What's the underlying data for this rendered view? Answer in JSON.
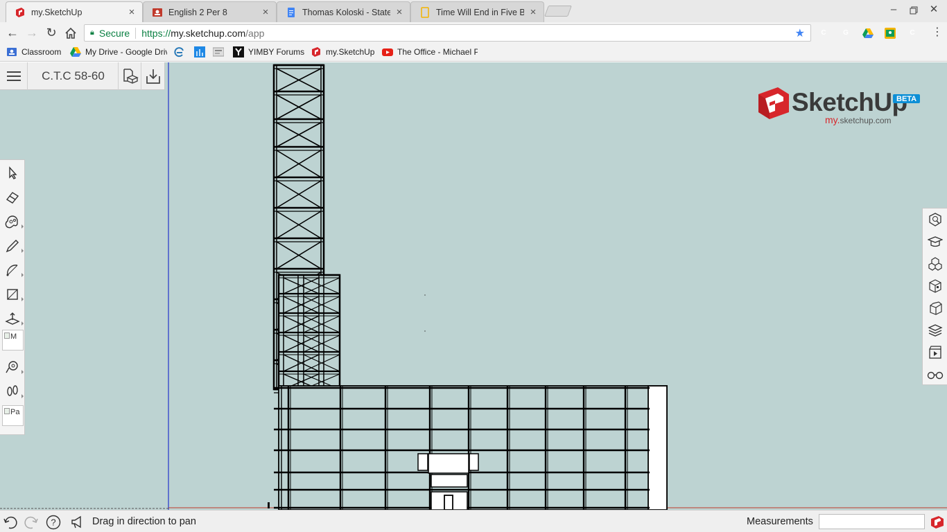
{
  "browser": {
    "tabs": [
      {
        "title": "my.SketchUp",
        "icon": "sketchup-icon",
        "active": true
      },
      {
        "title": "English 2 Per 8",
        "icon": "classroom-icon",
        "active": false
      },
      {
        "title": "Thomas Koloski - Statem",
        "icon": "docs-icon",
        "active": false
      },
      {
        "title": "Time Will End in Five Bill",
        "icon": "slides-icon",
        "active": false
      }
    ],
    "address": {
      "secure_label": "Secure",
      "scheme": "https://",
      "host": "my.sketchup.com",
      "path": "/app"
    },
    "extensions": [
      {
        "letter": "C",
        "color": "#a9a9a9"
      },
      {
        "letter": "G",
        "color": "#b3b3b3"
      },
      {
        "letter": "",
        "color": "#1e9f50"
      },
      {
        "letter": "",
        "color": "#f1b400"
      },
      {
        "letter": "C",
        "color": "#7a7a7a"
      }
    ],
    "bookmarks": [
      {
        "label": "Classroom",
        "icon": "classroom-icon"
      },
      {
        "label": "My Drive - Google Driv",
        "icon": "drive-icon"
      },
      {
        "label": "",
        "icon": "refresh-edge-icon"
      },
      {
        "label": "",
        "icon": "bars-icon"
      },
      {
        "label": "",
        "icon": "thumbnail-icon"
      },
      {
        "label": "YIMBY Forums",
        "icon": "yimby-icon"
      },
      {
        "label": "my.SketchUp",
        "icon": "sketchup-icon"
      },
      {
        "label": "The Office - Michael P",
        "icon": "youtube-icon"
      }
    ]
  },
  "app": {
    "model_title": "C.T.C 58-60",
    "logo": {
      "word": "SketchUp",
      "badge": "BETA",
      "sub_prefix": "my.",
      "sub_suffix": "sketchup.com"
    },
    "broken_images": {
      "first": "M",
      "second": "Pa"
    },
    "colors": {
      "sky": "#bdd3d2",
      "accent_red": "#d7262b",
      "axis_blue": "#2233cc"
    }
  },
  "status": {
    "hint": "Drag in direction to pan",
    "measurements_label": "Measurements",
    "measurements_value": ""
  }
}
